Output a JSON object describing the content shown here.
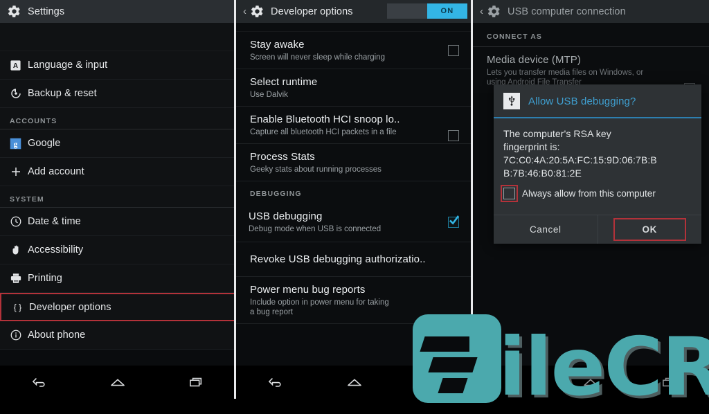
{
  "meta": {
    "accent_blue": "#33b5e5",
    "highlight_red": "#b3323a",
    "watermark_teal": "#4ba9ad"
  },
  "left_panel": {
    "actionbar": {
      "title": "Settings",
      "icon": "gear-icon"
    },
    "items": [
      {
        "icon": "language-icon",
        "label": "Language & input"
      },
      {
        "icon": "backup-icon",
        "label": "Backup & reset"
      },
      {
        "section": "ACCOUNTS"
      },
      {
        "icon": "google-icon",
        "label": "Google"
      },
      {
        "icon": "plus-icon",
        "label": "Add account"
      },
      {
        "section": "SYSTEM"
      },
      {
        "icon": "clock-icon",
        "label": "Date & time"
      },
      {
        "icon": "accessibility-icon",
        "label": "Accessibility"
      },
      {
        "icon": "printer-icon",
        "label": "Printing"
      },
      {
        "icon": "braces-icon",
        "label": "Developer options",
        "highlighted": true
      },
      {
        "icon": "info-icon",
        "label": "About phone"
      }
    ]
  },
  "mid_panel": {
    "actionbar": {
      "title": "Developer options",
      "back": "‹",
      "icon": "gear-icon",
      "toggle_label": "ON",
      "toggle_state": "on"
    },
    "rows": [
      {
        "title": "Stay awake",
        "subtitle": "Screen will never sleep while charging",
        "checkbox": "unchecked"
      },
      {
        "title": "Select runtime",
        "subtitle": "Use Dalvik"
      },
      {
        "title": "Enable Bluetooth HCI snoop lo..",
        "subtitle": "Capture all bluetooth HCI packets in a file",
        "checkbox": "unchecked"
      },
      {
        "title": "Process Stats",
        "subtitle": "Geeky stats about running processes"
      },
      {
        "section": "DEBUGGING"
      },
      {
        "title": "USB debugging",
        "subtitle": "Debug mode when USB is connected",
        "checkbox": "checked",
        "highlighted": true
      },
      {
        "title": "Revoke USB debugging authorizatio.."
      },
      {
        "title": "Power menu bug reports",
        "subtitle": "Include option in power menu for taking a bug report"
      }
    ]
  },
  "right_panel": {
    "actionbar": {
      "title": "USB computer connection",
      "back": "‹",
      "icon": "gear-icon"
    },
    "section": "CONNECT AS",
    "rows": [
      {
        "title": "Media device (MTP)",
        "subtitle": "Lets you transfer media files on Windows, or using Android File Transfer",
        "checkbox": "unchecked"
      }
    ],
    "dialog": {
      "icon": "usb-icon",
      "title": "Allow USB debugging?",
      "body_line1": "The computer's RSA key",
      "body_line2": "fingerprint is:",
      "body_line3": "7C:C0:4A:20:5A:FC:15:9D:06:7B:B",
      "body_line4": "B:7B:46:B0:81:2E",
      "checkbox_label": "Always allow from this computer",
      "checkbox_state": "unchecked",
      "cancel_label": "Cancel",
      "ok_label": "OK"
    }
  },
  "navbar": {
    "back": "back-icon",
    "home": "home-icon",
    "recents": "recents-icon"
  },
  "watermark": {
    "text": "ileCR",
    "mark": "filecr-logo-mark"
  }
}
